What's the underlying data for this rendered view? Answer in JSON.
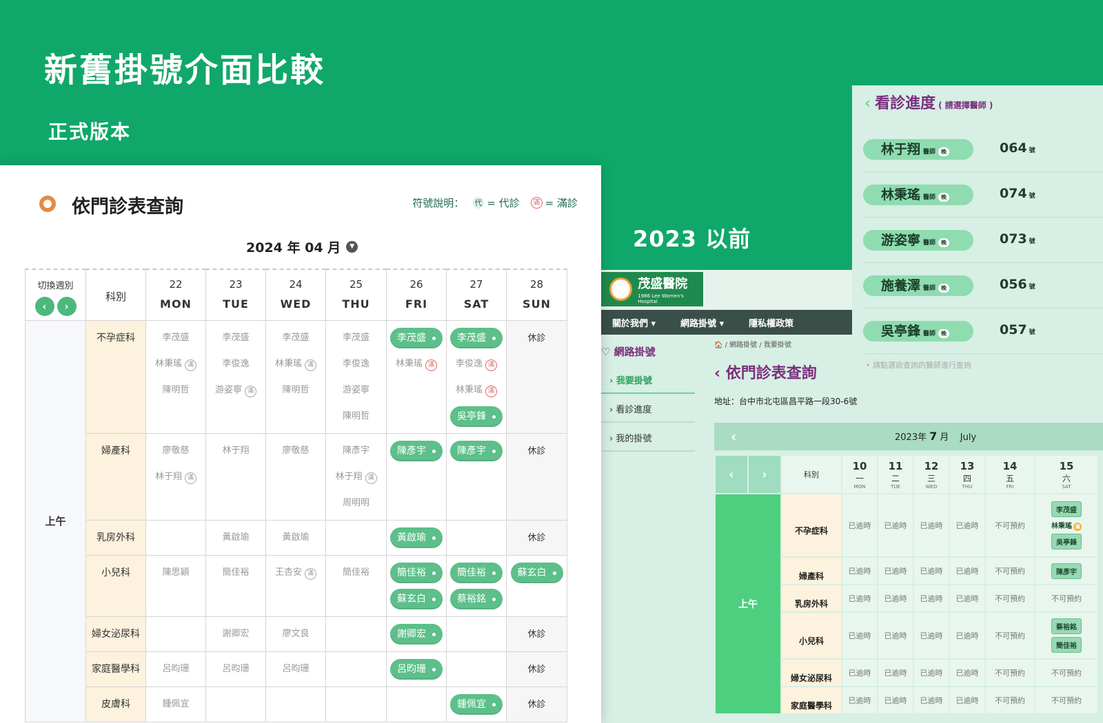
{
  "hero": {
    "title": "新舊掛號介面比較",
    "subtitle": "正式版本",
    "old_label": "2023 以前"
  },
  "colors": {
    "brand_green": "#0fa86a",
    "pill_green": "#5dbf8a",
    "dept_bg": "#fdf2dd",
    "full_red": "#e06a6a",
    "purple": "#7a2f7e"
  },
  "new_ui": {
    "title": "依門診表查詢",
    "legend_label": "符號說明：",
    "legend_dai_icon": "代",
    "legend_dai_text": "= 代診",
    "legend_man_icon": "滿",
    "legend_man_text": "= 滿診",
    "month": "2024 年 04 月",
    "switch_week": "切換週別",
    "dept_header": "科別",
    "days": [
      {
        "num": "22",
        "wk": "MON"
      },
      {
        "num": "23",
        "wk": "TUE"
      },
      {
        "num": "24",
        "wk": "WED"
      },
      {
        "num": "25",
        "wk": "THU"
      },
      {
        "num": "26",
        "wk": "FRI"
      },
      {
        "num": "27",
        "wk": "SAT"
      },
      {
        "num": "28",
        "wk": "SUN"
      }
    ],
    "period": "上午",
    "closed": "休診",
    "full_mark": "滿",
    "rows": [
      {
        "dept": "不孕症科",
        "cells": [
          [
            "李茂盛",
            "林秉瑤|滿",
            "陳明哲"
          ],
          [
            "李茂盛",
            "李俊逸",
            "游姿寧|滿"
          ],
          [
            "李茂盛",
            "林秉瑤|滿",
            "陳明哲"
          ],
          [
            "李茂盛",
            "李俊逸",
            "游姿寧",
            "陳明哲"
          ],
          [
            "李茂盛*",
            "林秉瑤|滿r"
          ],
          [
            "李茂盛*",
            "李俊逸|滿r",
            "林秉瑤|滿r",
            "吳亭鋒*"
          ],
          "closed"
        ]
      },
      {
        "dept": "婦產科",
        "cells": [
          [
            "廖敬慈",
            "林于翔|滿"
          ],
          [
            "林于翔"
          ],
          [
            "廖敬慈"
          ],
          [
            "陳彥宇",
            "林于翔|滿",
            "周明明"
          ],
          [
            "陳彥宇*"
          ],
          [
            "陳彥宇*"
          ],
          "closed"
        ]
      },
      {
        "dept": "乳房外科",
        "cells": [
          [],
          [
            "黃啟瑜"
          ],
          [
            "黃啟瑜"
          ],
          [],
          [
            "黃啟瑜*"
          ],
          [],
          "closed"
        ]
      },
      {
        "dept": "小兒科",
        "cells": [
          [
            "陳思穎"
          ],
          [
            "簡佳裕"
          ],
          [
            "王杏安|滿"
          ],
          [
            "簡佳裕"
          ],
          [
            "簡佳裕*",
            "蘇玄白*"
          ],
          [
            "簡佳裕*",
            "蔡裕銘*"
          ],
          [
            "蘇玄白*"
          ]
        ]
      },
      {
        "dept": "婦女泌尿科",
        "cells": [
          [],
          [
            "謝卿宏"
          ],
          [
            "廖文良"
          ],
          [],
          [
            "謝卿宏*"
          ],
          [],
          "closed"
        ]
      },
      {
        "dept": "家庭醫學科",
        "cells": [
          [
            "呂昀珊"
          ],
          [
            "呂昀珊"
          ],
          [
            "呂昀珊"
          ],
          [],
          [
            "呂昀珊*"
          ],
          [],
          "closed"
        ]
      },
      {
        "dept": "皮膚科",
        "cells": [
          [
            "鍾佩宜"
          ],
          [],
          [],
          [],
          [],
          [
            "鍾佩宜*"
          ],
          "closed"
        ]
      }
    ]
  },
  "progress": {
    "title": "看診進度",
    "hint": "( 請選擇醫師 )",
    "suffix_title": "醫師",
    "evening": "晚",
    "num_suffix": "號",
    "items": [
      {
        "name": "林于翔",
        "num": "064"
      },
      {
        "name": "林秉瑤",
        "num": "074"
      },
      {
        "name": "游姿寧",
        "num": "073"
      },
      {
        "name": "施養澤",
        "num": "056"
      },
      {
        "name": "吳亭鋒",
        "num": "057"
      }
    ],
    "note": "• 請點選欲查詢的醫師進行查詢"
  },
  "old_ui": {
    "logo_name": "茂盛醫院",
    "logo_en": "1986 Lee Women's Hospital",
    "nav": [
      "關於我們 ▾",
      "網路掛號 ▾",
      "隱私權政策"
    ],
    "side_head": "網路掛號",
    "side_items": [
      "我要掛號",
      "看診進度",
      "我的掛號"
    ],
    "breadcrumb": "🏠 / 網路掛號 / 我要掛號",
    "heading": "依門診表查詢",
    "address": "地址：台中市北屯區昌平路一段30-6號",
    "month_year": "2023年",
    "month_num": "7",
    "month_unit": "月",
    "month_en": "July",
    "dept_header": "科別",
    "days": [
      {
        "num": "10",
        "zh": "一",
        "en": "MON"
      },
      {
        "num": "11",
        "zh": "二",
        "en": "TUE"
      },
      {
        "num": "12",
        "zh": "三",
        "en": "WED"
      },
      {
        "num": "13",
        "zh": "四",
        "en": "THU"
      },
      {
        "num": "14",
        "zh": "五",
        "en": "FRI"
      },
      {
        "num": "15",
        "zh": "六",
        "en": "SAT"
      }
    ],
    "period": "上午",
    "past": "已逾時",
    "unavailable": "不可預約",
    "depts": [
      "不孕症科",
      "婦產科",
      "乳房外科",
      "小兒科",
      "婦女泌尿科",
      "家庭醫學科"
    ],
    "sat_cells": [
      [
        "李茂盛",
        "林秉瑤|滿",
        "吳亭鋒"
      ],
      [
        "陳彥宇"
      ],
      [
        "不可預約"
      ],
      [
        "蔡裕銘",
        "簡佳裕"
      ],
      [
        "不可預約"
      ],
      [
        "不可預約"
      ]
    ]
  }
}
